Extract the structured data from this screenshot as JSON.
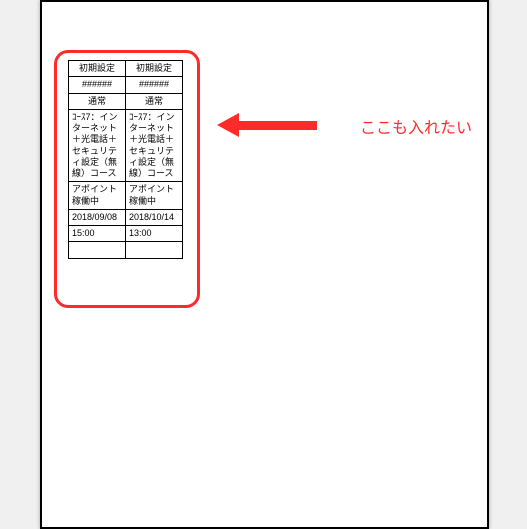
{
  "annotation": {
    "text": "ここも入れたい"
  },
  "table": {
    "rows": [
      {
        "c1": "初期設定",
        "c2": "初期設定",
        "align": "ctr"
      },
      {
        "c1": "######",
        "c2": "######",
        "align": "ctr"
      },
      {
        "c1": "通常",
        "c2": "通常",
        "align": "ctr"
      },
      {
        "c1": "ｺｰｽ7：インターネット＋光電話＋セキュリティ設定（無線）コース",
        "c2": "ｺｰｽ7：インターネット＋光電話＋セキュリティ設定（無線）コース",
        "align": ""
      },
      {
        "c1": "アポイント稼働中",
        "c2": "アポイント稼働中",
        "align": ""
      },
      {
        "c1": "2018/09/08",
        "c2": "2018/10/14",
        "align": ""
      },
      {
        "c1": "15:00",
        "c2": "13:00",
        "align": ""
      },
      {
        "c1": "",
        "c2": "",
        "align": "empty"
      }
    ]
  }
}
